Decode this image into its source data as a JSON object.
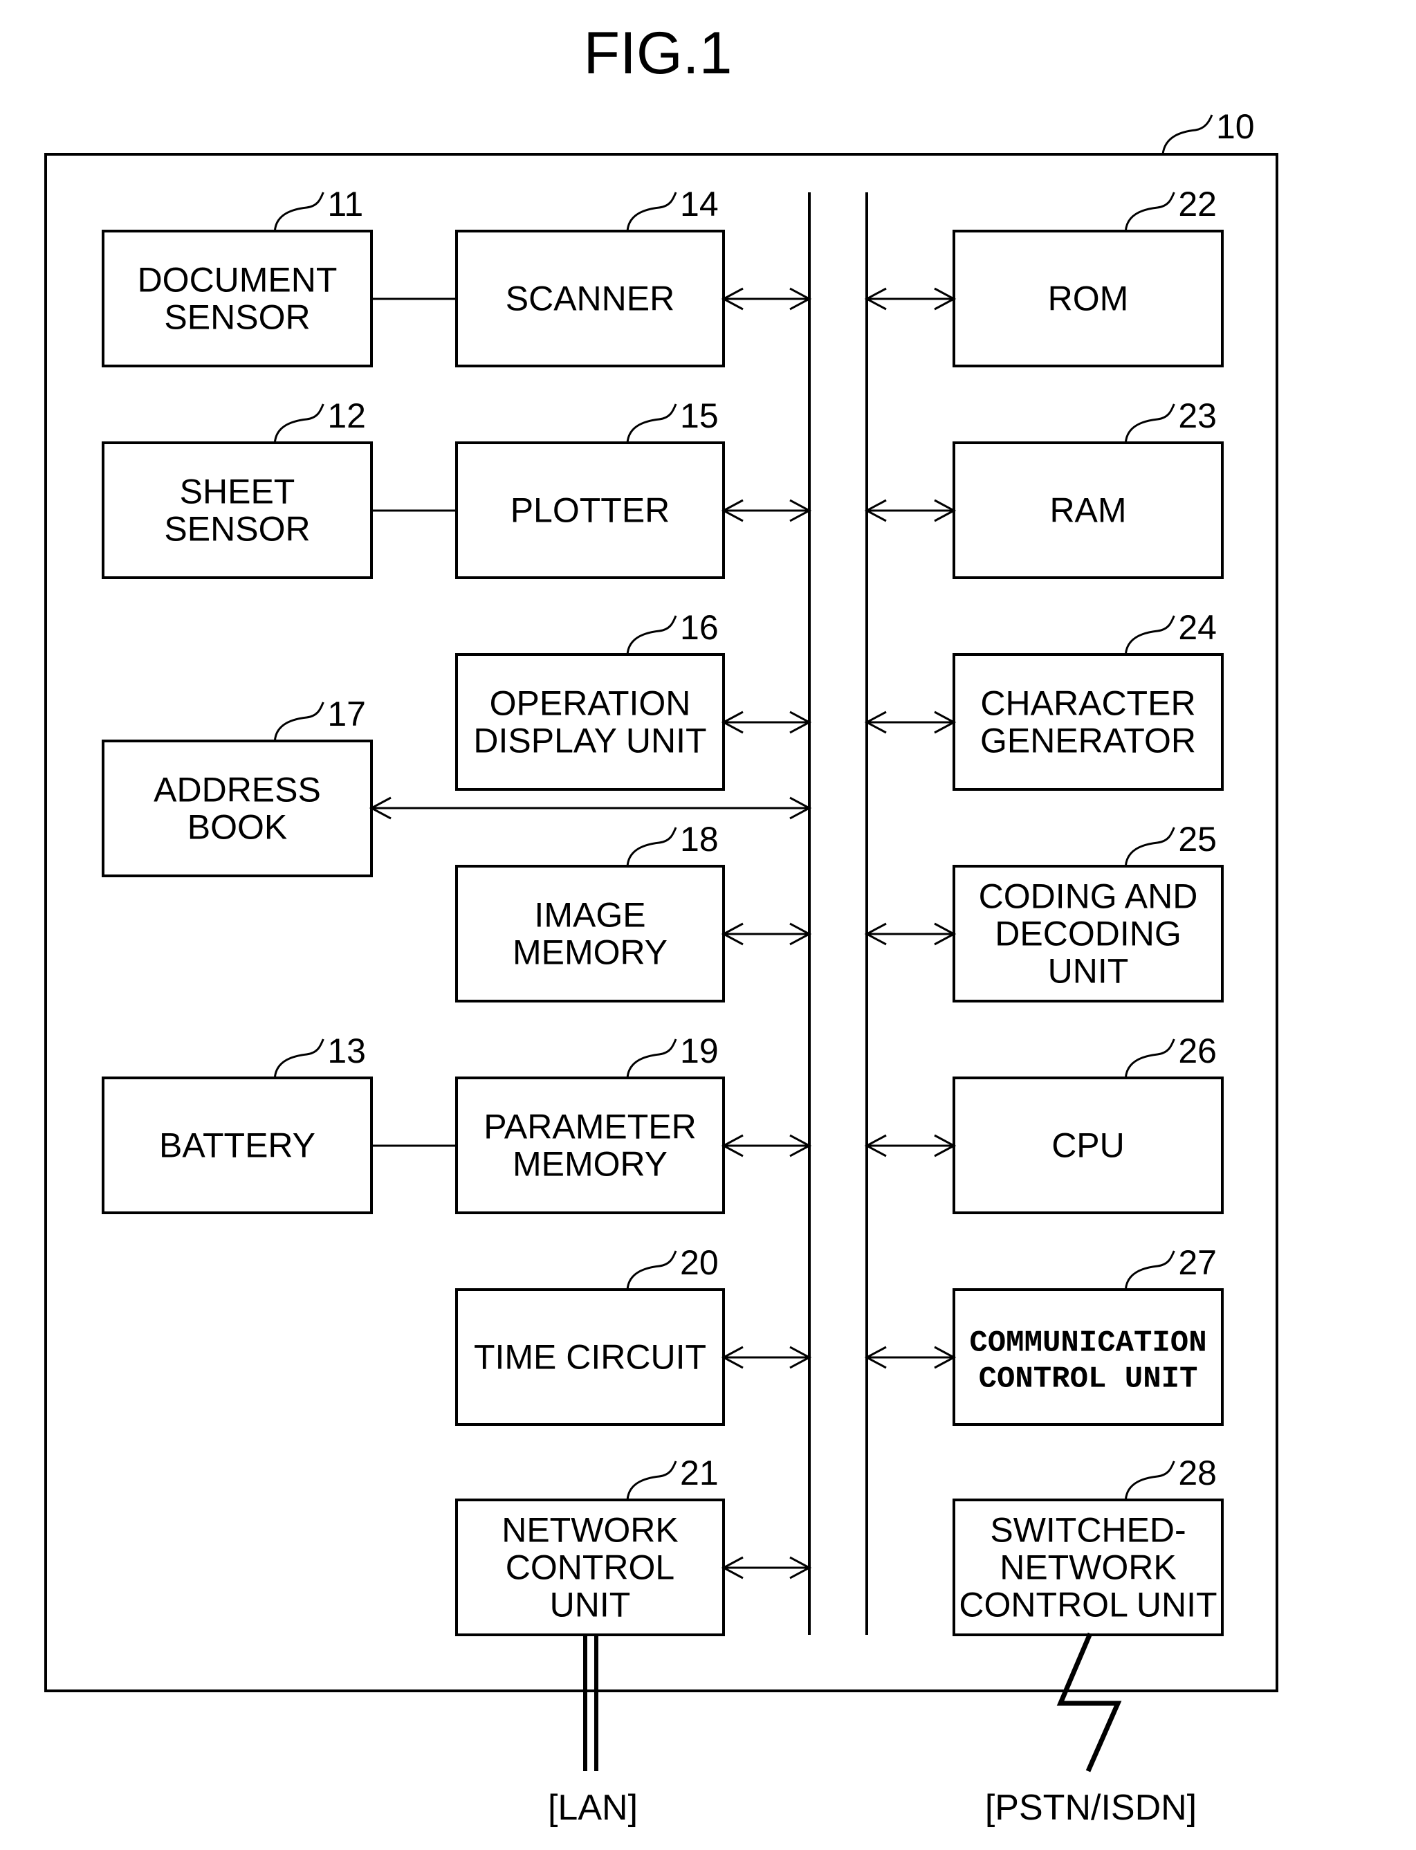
{
  "figure": {
    "title": "FIG.1",
    "device_ref": "10"
  },
  "left_column": [
    {
      "id": "document-sensor",
      "ref": "11",
      "lines": [
        "DOCUMENT",
        "SENSOR"
      ]
    },
    {
      "id": "sheet-sensor",
      "ref": "12",
      "lines": [
        "SHEET",
        "SENSOR"
      ]
    },
    {
      "id": "address-book",
      "ref": "17",
      "lines": [
        "ADDRESS",
        "BOOK"
      ]
    },
    {
      "id": "battery",
      "ref": "13",
      "lines": [
        "BATTERY"
      ]
    }
  ],
  "middle_column": [
    {
      "id": "scanner",
      "ref": "14",
      "lines": [
        "SCANNER"
      ]
    },
    {
      "id": "plotter",
      "ref": "15",
      "lines": [
        "PLOTTER"
      ]
    },
    {
      "id": "operation-display-unit",
      "ref": "16",
      "lines": [
        "OPERATION",
        "DISPLAY UNIT"
      ]
    },
    {
      "id": "image-memory",
      "ref": "18",
      "lines": [
        "IMAGE",
        "MEMORY"
      ]
    },
    {
      "id": "parameter-memory",
      "ref": "19",
      "lines": [
        "PARAMETER",
        "MEMORY"
      ]
    },
    {
      "id": "time-circuit",
      "ref": "20",
      "lines": [
        "TIME CIRCUIT"
      ]
    },
    {
      "id": "network-control-unit",
      "ref": "21",
      "lines": [
        "NETWORK",
        "CONTROL",
        "UNIT"
      ]
    }
  ],
  "right_column": [
    {
      "id": "rom",
      "ref": "22",
      "lines": [
        "ROM"
      ]
    },
    {
      "id": "ram",
      "ref": "23",
      "lines": [
        "RAM"
      ]
    },
    {
      "id": "character-generator",
      "ref": "24",
      "lines": [
        "CHARACTER",
        "GENERATOR"
      ]
    },
    {
      "id": "coding-and-decoding-unit",
      "ref": "25",
      "lines": [
        "CODING AND",
        "DECODING",
        "UNIT"
      ]
    },
    {
      "id": "cpu",
      "ref": "26",
      "lines": [
        "CPU"
      ]
    },
    {
      "id": "communication-control-unit",
      "ref": "27",
      "lines": [
        "COMMUNICATION",
        "CONTROL UNIT"
      ],
      "mono": true
    },
    {
      "id": "switched-network-control-unit",
      "ref": "28",
      "lines": [
        "SWITCHED-",
        "NETWORK",
        "CONTROL UNIT"
      ]
    }
  ],
  "external": {
    "lan_label": "[LAN]",
    "pstn_label": "[PSTN/ISDN]"
  }
}
